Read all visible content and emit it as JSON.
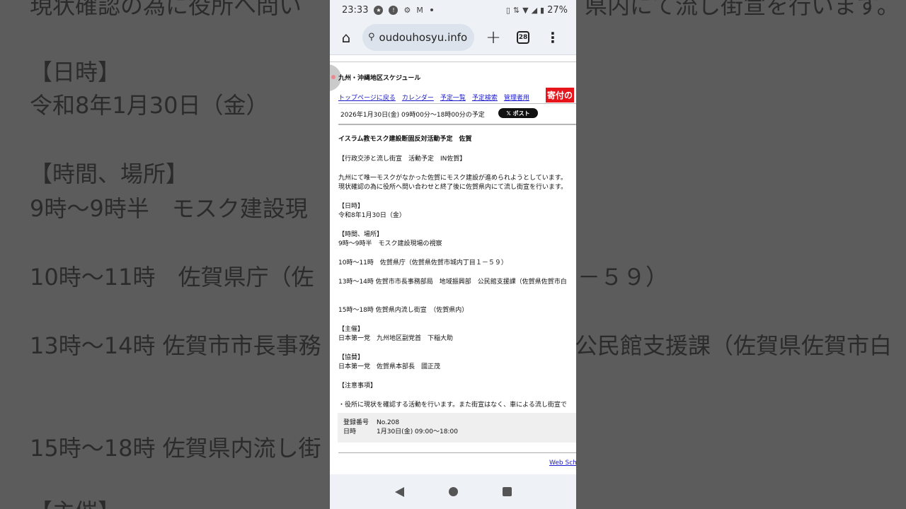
{
  "background_text": [
    "現状確認の為に役所へ問い",
    "県内にて流し街宣を行います。",
    "【日時】",
    "令和8年1月30日（金）",
    "【時間、場所】",
    "9時～9時半　モスク建設現",
    "10時～11時　佐賀県庁（佐",
    "－５９）",
    "13時～14時 佐賀市市長事務",
    "公民館支援課（佐賀県佐賀市白",
    "15時～18時 佐賀県内流し街",
    "【主催】"
  ],
  "statusbar": {
    "time": "23:33",
    "battery": "27%"
  },
  "browser": {
    "url": "oudouhosyu.info",
    "tab_count": "28"
  },
  "site": {
    "title": "九州・沖縄地区スケジュール",
    "nav": [
      "トップページに戻る",
      "カレンダー",
      "予定一覧",
      "予定検索",
      "管理者用"
    ],
    "donate": "寄付の",
    "date_line": "2026年1月30日(金) 09時00分～18時00分の予定",
    "post_button": "𝕏 ポスト"
  },
  "event": {
    "title": "イスラム教モスク建設断固反対活動予定　佐賀",
    "subtitle": "【行政交渉と流し街宣　活動予定　IN佐賀】",
    "intro_1": "九州にて唯一モスクがなかった佐賀にモスク建設が進められようとしています。",
    "intro_2": "現状確認の為に役所へ問い合わせと終了後に佐賀県内にて流し街宣を行います。",
    "date_head": "【日時】",
    "date_value": "令和8年1月30日（金）",
    "place_head": "【時間、場所】",
    "place_1": "9時～9時半　モスク建設現場の視察",
    "place_2": "10時～11時　佐賀県庁（佐賀県佐賀市城内丁目１－５９）",
    "place_3": "13時～14時  佐賀市市長事務部局　地域振興部　公民館支援課（佐賀県佐賀市白",
    "place_4": "15時～18時  佐賀県内流し街宣　（佐賀県内）",
    "host_head": "【主催】",
    "host_value": "日本第一党　九州地区副党首　下稲大助",
    "co_head": "【協賛】",
    "co_value": "日本第一党　佐賀県本部長　國正茂",
    "note_head": "【注意事項】",
    "note_value": "・役所に現状を確認する活動を行います。また街宣はなく、車による流し街宣で"
  },
  "registration": {
    "number_label": "登録番号",
    "number_value": "No.208",
    "date_label": "日時",
    "date_value": "1月30日(金) 09:00～18:00"
  },
  "footer_link": "Web Sch"
}
